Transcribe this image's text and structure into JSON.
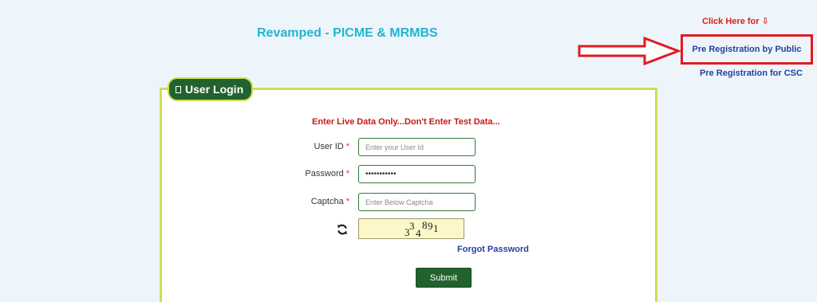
{
  "header": {
    "app_title": "Revamped - PICME & MRMBS",
    "click_here": "Click Here for ⇩",
    "pre_registration_public": "Pre Registration by Public",
    "pre_registration_csc": "Pre Registration for CSC"
  },
  "login": {
    "tab_title": "User Login",
    "warning": "Enter Live Data Only...Don't Enter Test Data...",
    "user_id_label": "User ID",
    "user_id_placeholder": "Enter your User Id",
    "password_label": "Password",
    "password_value": "•••••••••••",
    "captcha_label": "Captcha",
    "captcha_placeholder": "Enter Below Captcha",
    "captcha_chars": [
      "3",
      "3",
      "4",
      "8",
      "9",
      "1"
    ],
    "required_mark": "*",
    "forgot_password": "Forgot Password",
    "submit_label": "Submit"
  },
  "colors": {
    "accent_green": "#22622e",
    "border_lime": "#cfdd55",
    "title_cyan": "#1fb5d4",
    "alert_red": "#e11b22",
    "link_blue": "#233f9f"
  },
  "icons": {
    "user": "user-icon",
    "refresh": "refresh-icon",
    "arrow": "arrow-right-icon"
  }
}
